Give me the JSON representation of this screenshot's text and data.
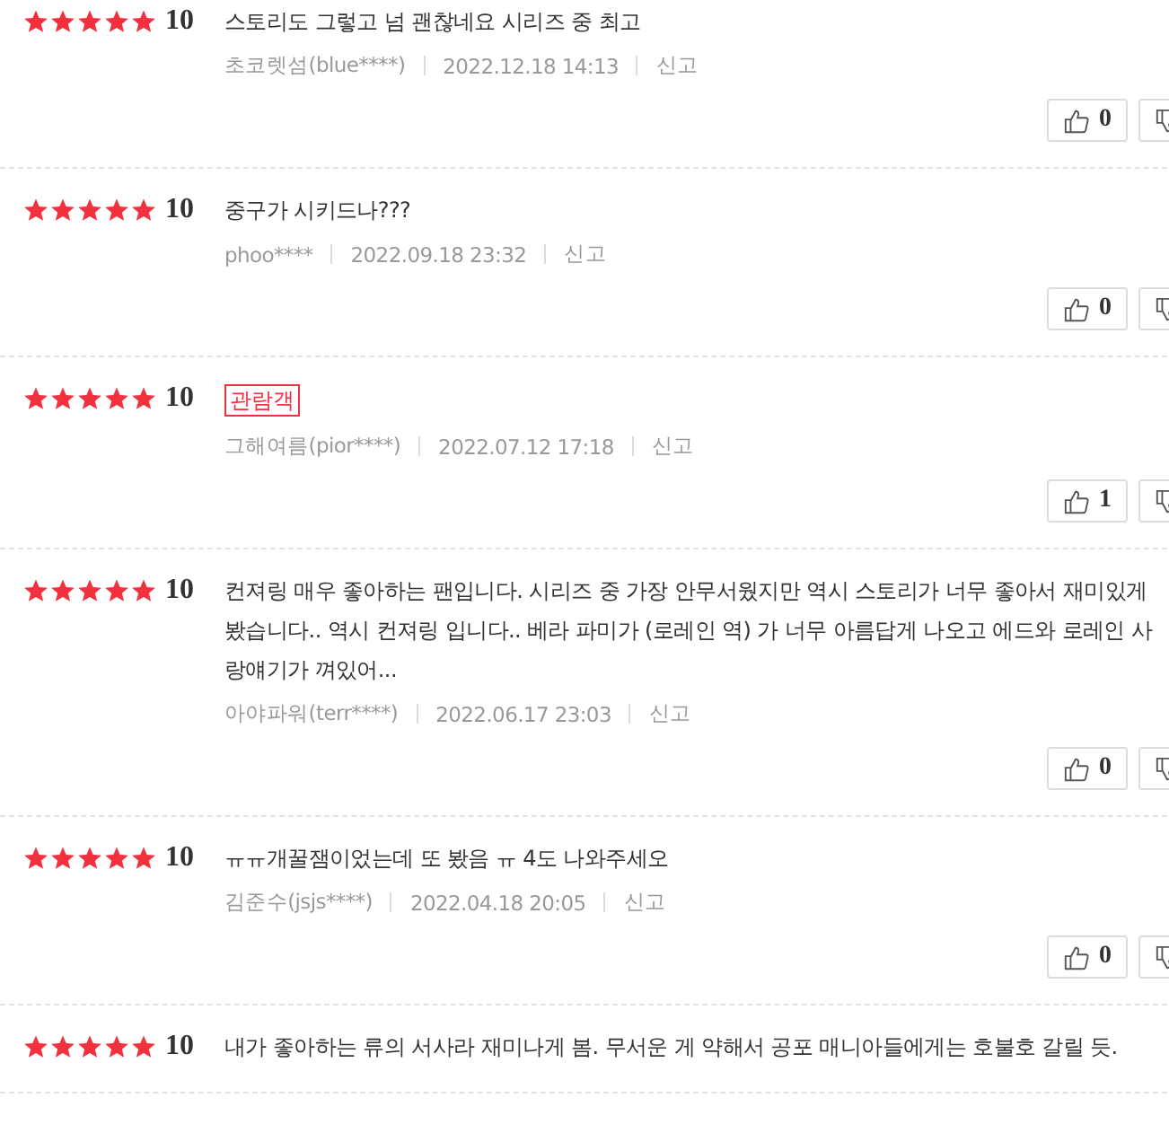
{
  "reviews": [
    {
      "stars": 5,
      "score": "10",
      "text": "스토리도 그렇고 넘 괜찮네요 시리즈 중 최고",
      "author": "초코렛섬(blue****)",
      "date": "2022.12.18 14:13",
      "report": "신고",
      "likes": "0"
    },
    {
      "stars": 5,
      "score": "10",
      "text": "중구가 시키드나???",
      "author": "phoo****",
      "date": "2022.09.18 23:32",
      "report": "신고",
      "likes": "0"
    },
    {
      "stars": 5,
      "score": "10",
      "badge": "관람객",
      "author": "그해여름(pior****)",
      "date": "2022.07.12 17:18",
      "report": "신고",
      "likes": "1"
    },
    {
      "stars": 5,
      "score": "10",
      "text": "컨져링 매우 좋아하는 팬입니다. 시리즈 중 가장 안무서웠지만 역시 스토리가 너무 좋아서 재미있게 봤습니다.. 역시 컨져링 입니다.. 베라 파미가 (로레인 역) 가 너무 아름답게 나오고 에드와 로레인 사랑얘기가 껴있어...",
      "author": "아야파워(terr****)",
      "date": "2022.06.17 23:03",
      "report": "신고",
      "likes": "0"
    },
    {
      "stars": 5,
      "score": "10",
      "text": "ㅠㅠ개꿀잼이었는데 또 봤음 ㅠ 4도 나와주세오",
      "author": "김준수(jsjs****)",
      "date": "2022.04.18 20:05",
      "report": "신고",
      "likes": "0"
    },
    {
      "stars": 5,
      "score": "10",
      "text": "내가 좋아하는 류의 서사라 재미나게 봄. 무서운 게 약해서 공포 매니아들에게는 호불호 갈릴 듯."
    }
  ]
}
